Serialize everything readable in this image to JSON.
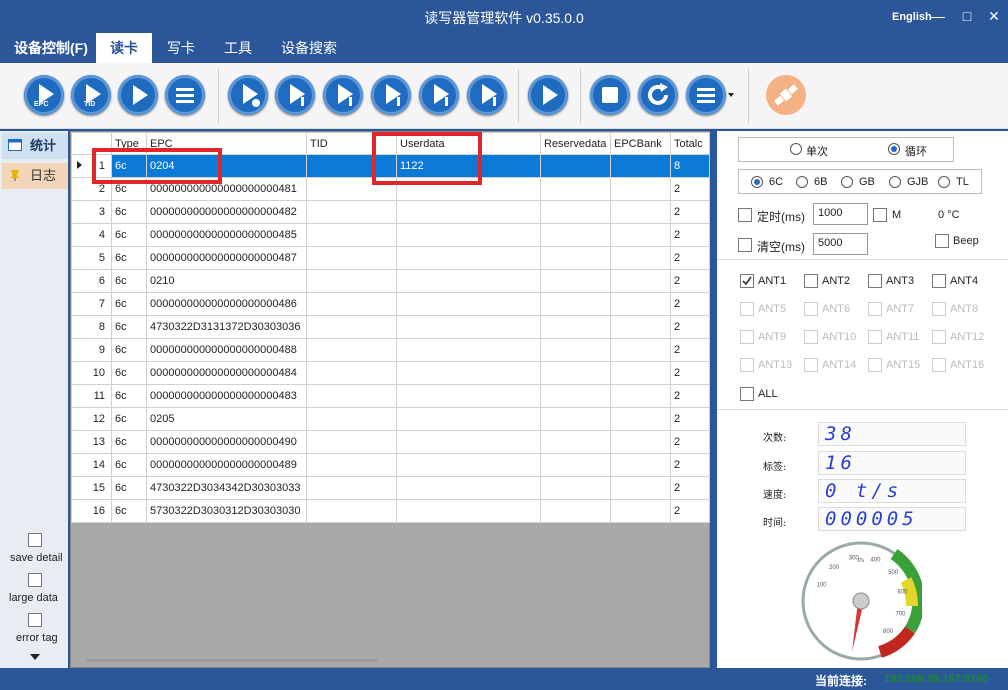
{
  "app": {
    "title": "读写器管理软件 v0.35.0.0",
    "language": "English",
    "minimize": "—",
    "maximize": "□",
    "close": "✕"
  },
  "menu": [
    "设备控制(F)",
    "读卡",
    "写卡",
    "工具",
    "设备搜索"
  ],
  "toolbar": {
    "buttons": [
      "read-epc",
      "read-tid",
      "play",
      "list",
      "read-user",
      "temp-1",
      "temp-2",
      "temp-3",
      "temp-4",
      "temp-5",
      "start",
      "stop",
      "refresh",
      "menu-dropdown",
      "satellite"
    ],
    "epc_label": "EPC",
    "tid_label": "TID",
    "accent": "#1e6bbf",
    "satellite_color": "#f4b183"
  },
  "leftnav": {
    "items": [
      "统计",
      "日志"
    ],
    "options": [
      "save detail",
      "large data",
      "error tag"
    ]
  },
  "table": {
    "columns": [
      "",
      "Type",
      "EPC",
      "TID",
      "Userdata",
      "Reservedata",
      "EPCBank",
      "Totalc"
    ],
    "rows": [
      [
        "1",
        "6c",
        "0204",
        "",
        "1122",
        "",
        "",
        "8"
      ],
      [
        "2",
        "6c",
        "000000000000000000000481",
        "",
        "",
        "",
        "",
        "2"
      ],
      [
        "3",
        "6c",
        "000000000000000000000482",
        "",
        "",
        "",
        "",
        "2"
      ],
      [
        "4",
        "6c",
        "000000000000000000000485",
        "",
        "",
        "",
        "",
        "2"
      ],
      [
        "5",
        "6c",
        "000000000000000000000487",
        "",
        "",
        "",
        "",
        "2"
      ],
      [
        "6",
        "6c",
        "0210",
        "",
        "",
        "",
        "",
        "2"
      ],
      [
        "7",
        "6c",
        "000000000000000000000486",
        "",
        "",
        "",
        "",
        "2"
      ],
      [
        "8",
        "6c",
        "4730322D3131372D30303036",
        "",
        "",
        "",
        "",
        "2"
      ],
      [
        "9",
        "6c",
        "000000000000000000000488",
        "",
        "",
        "",
        "",
        "2"
      ],
      [
        "10",
        "6c",
        "000000000000000000000484",
        "",
        "",
        "",
        "",
        "2"
      ],
      [
        "11",
        "6c",
        "000000000000000000000483",
        "",
        "",
        "",
        "",
        "2"
      ],
      [
        "12",
        "6c",
        "0205",
        "",
        "",
        "",
        "",
        "2"
      ],
      [
        "13",
        "6c",
        "000000000000000000000490",
        "",
        "",
        "",
        "",
        "2"
      ],
      [
        "14",
        "6c",
        "000000000000000000000489",
        "",
        "",
        "",
        "",
        "2"
      ],
      [
        "15",
        "6c",
        "4730322D3034342D30303033",
        "",
        "",
        "",
        "",
        "2"
      ],
      [
        "16",
        "6c",
        "5730322D3030312D30303030",
        "",
        "",
        "",
        "",
        "2"
      ]
    ]
  },
  "settings": {
    "mode": {
      "options": [
        "单次",
        "循环"
      ],
      "selected": "循环"
    },
    "protocol": {
      "options": [
        "6C",
        "6B",
        "GB",
        "GJB",
        "TL"
      ],
      "selected": "6C"
    },
    "timing_label": "定时(ms)",
    "timing_value": "1000",
    "m_label": "M",
    "temp": "0 °C",
    "clear_label": "清空(ms)",
    "clear_value": "5000",
    "beep_label": "Beep",
    "antennas": [
      "ANT1",
      "ANT2",
      "ANT3",
      "ANT4",
      "ANT5",
      "ANT6",
      "ANT7",
      "ANT8",
      "ANT9",
      "ANT10",
      "ANT11",
      "ANT12",
      "ANT13",
      "ANT14",
      "ANT15",
      "ANT16"
    ],
    "ant1_checked": true,
    "all_label": "ALL"
  },
  "stats": {
    "count_label": "次数:",
    "count": "38",
    "tags_label": "标签:",
    "tags": "16",
    "speed_label": "速度:",
    "speed": "0 t/s",
    "time_label": "时间:",
    "time": "000005"
  },
  "gauge": {
    "ticks": [
      "100",
      "200",
      "300",
      "400",
      "500",
      "600",
      "700",
      "800"
    ],
    "unit": "t/s",
    "value": 0
  },
  "status": {
    "label": "当前连接:",
    "value": "192.168.28.167:8160"
  }
}
